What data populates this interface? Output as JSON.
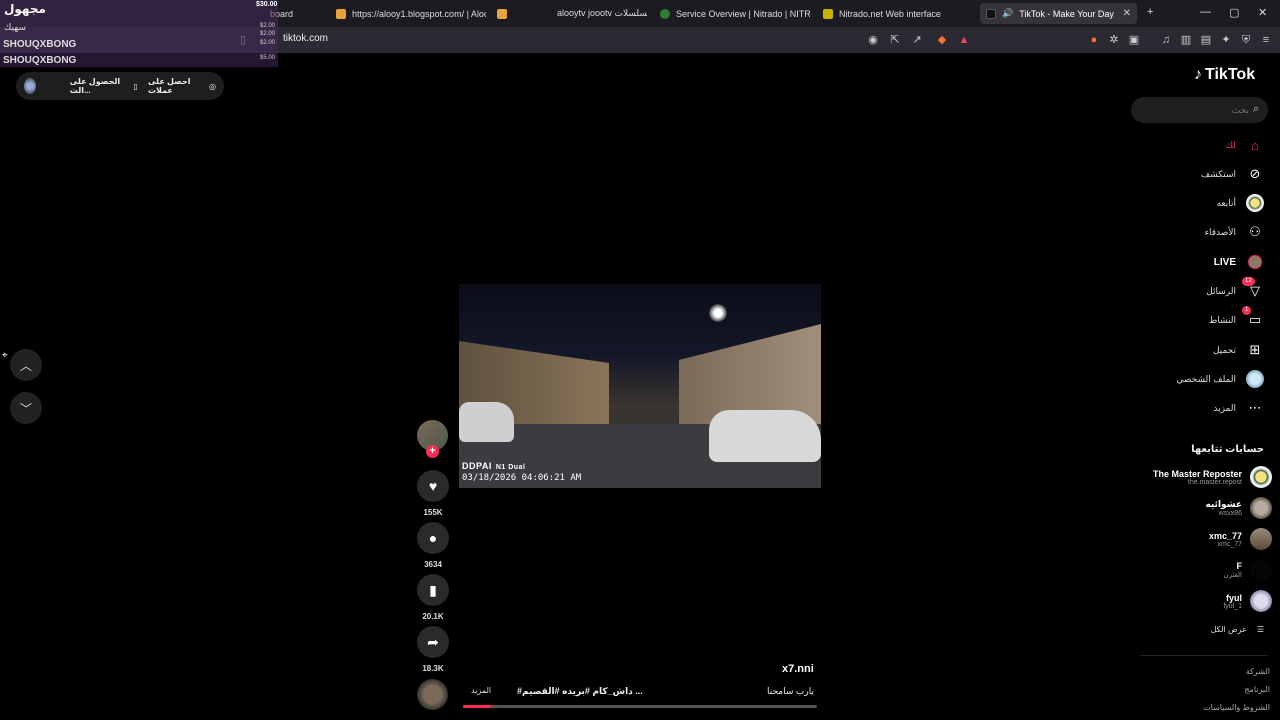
{
  "browser": {
    "tabs": [
      {
        "label": "board"
      },
      {
        "label": "https://alooy1.blogspot.com/ | Aloo"
      },
      {
        "label": "alooytv joootv مسلسلات"
      },
      {
        "label": "Service Overview | Nitrado | NITRADO"
      },
      {
        "label": "Nitrado.net Web interface"
      },
      {
        "label": "TikTok - Make Your Day",
        "active": true
      }
    ],
    "new_tab": "+",
    "url": "tiktok.com"
  },
  "overlay": {
    "name": "مجهول",
    "amount": "$30.00",
    "sub": "سهيك",
    "rows": [
      "SHOUQXBONG",
      "SHOUQXBONG"
    ],
    "small_amounts": [
      "$2.00",
      "$2.00",
      "$2.00",
      "$5.00"
    ]
  },
  "coins": {
    "get_coins": "احصل على عملات",
    "get_app": "الحصول على الت..."
  },
  "video": {
    "brand": "DDPAI",
    "model": "N1 Dual",
    "timestamp": "03/18/2026 04:06:21 AM",
    "progress": 0.08
  },
  "actions": {
    "likes": "155K",
    "comments": "3634",
    "saves": "20.1K",
    "shares": "18.3K"
  },
  "post": {
    "username": "x7.nni",
    "caption": "يارب سامحنا",
    "hashtags": "#داش_كام #بريده #القصيم ...",
    "more": "المزيد"
  },
  "sidebar": {
    "logo": "TikTok",
    "search_placeholder": "بحث",
    "nav": [
      {
        "label": "لك",
        "icon": "home-icon"
      },
      {
        "label": "استكشف",
        "icon": "compass-icon"
      },
      {
        "label": "أتابعه",
        "icon": "avatar-icon"
      },
      {
        "label": "الأصدقاء",
        "icon": "friends-icon"
      },
      {
        "label": "LIVE",
        "icon": "live-icon"
      },
      {
        "label": "الرسائل",
        "icon": "messages-icon",
        "badge": "12"
      },
      {
        "label": "النشاط",
        "icon": "activity-icon",
        "badge": "1"
      },
      {
        "label": "تحميل",
        "icon": "upload-icon"
      },
      {
        "label": "الملف الشخصي",
        "icon": "profile-icon"
      },
      {
        "label": "المزيد",
        "icon": "more-icon"
      }
    ],
    "following_title": "حسابات تتابعها",
    "following": [
      {
        "name": "The Master Reposter",
        "handle": "the.master.repost"
      },
      {
        "name": "عشوائيه",
        "handle": "wsvx86"
      },
      {
        "name": "xmc_77",
        "handle": "xmc_77"
      },
      {
        "name": "F",
        "handle": "الغثرن"
      },
      {
        "name": "fyul",
        "handle": "fyul_1"
      }
    ],
    "see_all": "عرض الكل",
    "footer": [
      "الشركة",
      "البرنامج",
      "الشروط والسياسات"
    ]
  }
}
